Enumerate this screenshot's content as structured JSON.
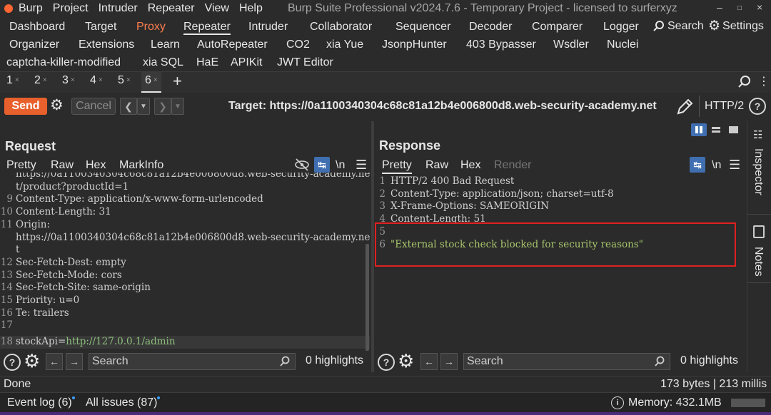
{
  "menu": [
    "Burp",
    "Project",
    "Intruder",
    "Repeater",
    "View",
    "Help"
  ],
  "app_title": "Burp Suite Professional v2024.7.6 - Temporary Project - licensed to surferxyz",
  "tools_row1": [
    "Dashboard",
    "Target",
    "Proxy",
    "Repeater",
    "Intruder",
    "Collaborator",
    "Sequencer",
    "Decoder",
    "Comparer",
    "Logger"
  ],
  "tools_row1_right": {
    "search": "Search",
    "settings": "Settings"
  },
  "tools_row2": [
    "Organizer",
    "Extensions",
    "Learn",
    "AutoRepeater",
    "CO2",
    "xia Yue",
    "JsonpHunter",
    "403 Bypasser",
    "Wsdler",
    "Nuclei"
  ],
  "tools_row3": [
    "captcha-killer-modified",
    "xia SQL",
    "HaE",
    "APIKit",
    "JWT Editor"
  ],
  "repeater_tabs": [
    "1",
    "2",
    "3",
    "4",
    "5",
    "6"
  ],
  "tab_close": "×",
  "toolbar": {
    "send": "Send",
    "cancel": "Cancel",
    "target": "Target: https://0a1100340304c68c81a12b4e006800d8.web-security-academy.net",
    "protocol": "HTTP/2"
  },
  "request": {
    "title": "Request",
    "tabs": [
      "Pretty",
      "Raw",
      "Hex",
      "MarkInfo"
    ],
    "lines": [
      {
        "n": "",
        "t": "https://0a1100340304c68c81a12b4e006800d8.web-security-academy.ne"
      },
      {
        "n": "",
        "t": "t/product?productId=1"
      },
      {
        "n": "9",
        "t": "Content-Type: application/x-www-form-urlencoded"
      },
      {
        "n": "10",
        "t": "Content-Length: 31"
      },
      {
        "n": "11",
        "t": "Origin:"
      },
      {
        "n": "",
        "t": "https://0a1100340304c68c81a12b4e006800d8.web-security-academy.ne"
      },
      {
        "n": "",
        "t": "t"
      },
      {
        "n": "12",
        "t": "Sec-Fetch-Dest: empty"
      },
      {
        "n": "13",
        "t": "Sec-Fetch-Mode: cors"
      },
      {
        "n": "14",
        "t": "Sec-Fetch-Site: same-origin"
      },
      {
        "n": "15",
        "t": "Priority: u=0"
      },
      {
        "n": "16",
        "t": "Te: trailers"
      },
      {
        "n": "17",
        "t": ""
      }
    ],
    "last_line": {
      "n": "18",
      "key": "stockApi",
      "eq": "=",
      "value": "http://127.0.0.1/admin"
    }
  },
  "response": {
    "title": "Response",
    "tabs": [
      "Pretty",
      "Raw",
      "Hex",
      "Render"
    ],
    "lines": [
      {
        "n": "1",
        "t": "HTTP/2 400 Bad Request"
      },
      {
        "n": "2",
        "t": "Content-Type: application/json; charset=utf-8"
      },
      {
        "n": "3",
        "t": "X-Frame-Options: SAMEORIGIN"
      },
      {
        "n": "4",
        "t": "Content-Length: 51"
      },
      {
        "n": "5",
        "t": ""
      },
      {
        "n": "6",
        "t": "\"External stock check blocked for security reasons\""
      }
    ]
  },
  "newline_toggle": "\\n",
  "search": {
    "placeholder": "Search",
    "highlights": "0 highlights"
  },
  "status": {
    "left": "Done",
    "right": "173 bytes | 213 millis"
  },
  "footer": {
    "event_log": "Event log (6)",
    "all_issues": "All issues (87)",
    "memory": "Memory: 432.1MB"
  },
  "sidebar": {
    "inspector": "Inspector",
    "notes": "Notes"
  },
  "colors": {
    "accent": "#e8612c",
    "highlight_box": "#e02020"
  }
}
